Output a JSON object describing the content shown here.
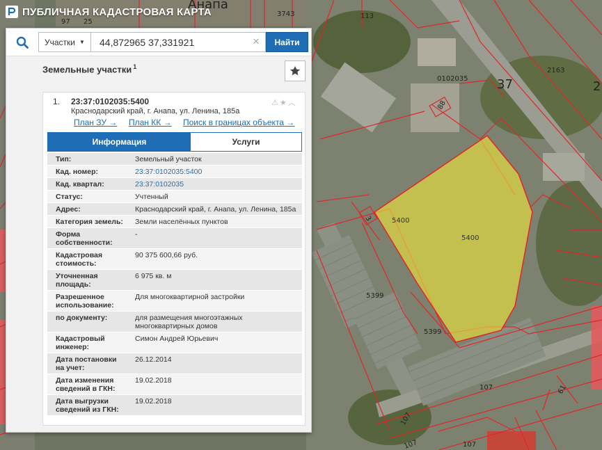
{
  "app": {
    "title": "ПУБЛИЧНАЯ КАДАСТРОВАЯ КАРТА"
  },
  "search": {
    "type_label": "Участки",
    "query": "44,872965 37,331921",
    "find_label": "Найти"
  },
  "results": {
    "header": "Земельные участки",
    "count": "1",
    "item": {
      "index": "1.",
      "cadastral_number": "23:37:0102035:5400",
      "address": "Краснодарский край, г. Анапа, ул. Ленина, 185а",
      "links": [
        "План ЗУ →",
        "План КК →",
        "Поиск в границах объекта →"
      ],
      "tabs": [
        "Информация",
        "Услуги"
      ],
      "attributes": [
        {
          "key": "Тип:",
          "value": "Земельный участок"
        },
        {
          "key": "Кад. номер:",
          "value": "23:37:0102035:5400"
        },
        {
          "key": "Кад. квартал:",
          "value": "23:37:0102035"
        },
        {
          "key": "Статус:",
          "value": "Учтенный"
        },
        {
          "key": "Адрес:",
          "value": "Краснодарский край, г. Анапа, ул. Ленина, 185а"
        },
        {
          "key": "Категория земель:",
          "value": "Земли населённых пунктов"
        },
        {
          "key": "Форма собственности:",
          "value": "-"
        },
        {
          "key": "Кадастровая стоимость:",
          "value": "90 375 600,66 руб."
        },
        {
          "key": "Уточненная площадь:",
          "value": "6 975 кв. м"
        },
        {
          "key": "Разрешенное использование:",
          "value": "Для многоквартирной застройки"
        },
        {
          "key": "по документу:",
          "value": "для размещения многоэтажных многоквартирных домов"
        },
        {
          "key": "Кадастровый инженер:",
          "value": "Симон Андрей Юрьевич"
        },
        {
          "key": "Дата постановки на учет:",
          "value": "26.12.2014"
        },
        {
          "key": "Дата изменения сведений в ГКН:",
          "value": "19.02.2018"
        },
        {
          "key": "Дата выгрузки сведений из ГКН:",
          "value": "19.02.2018"
        }
      ]
    }
  },
  "map": {
    "labels": {
      "city": "Анапа",
      "l3743": "3743",
      "l113": "113",
      "l97": "97",
      "l25": "25",
      "l0102035": "0102035",
      "l37": "37",
      "l2163": "2163",
      "l2": "2",
      "l88": "88",
      "l5400a": "5400",
      "l5400b": "5400",
      "l3": "3",
      "l5399a": "5399",
      "l5399b": "5399",
      "l107a": "107",
      "l107b": "107",
      "l107c": "107",
      "l107d": "107",
      "l61": "61"
    },
    "colors": {
      "parcel_border": "#e0262a",
      "selected_fill": "#f1ea3a",
      "accent": "#1f6db5"
    }
  }
}
